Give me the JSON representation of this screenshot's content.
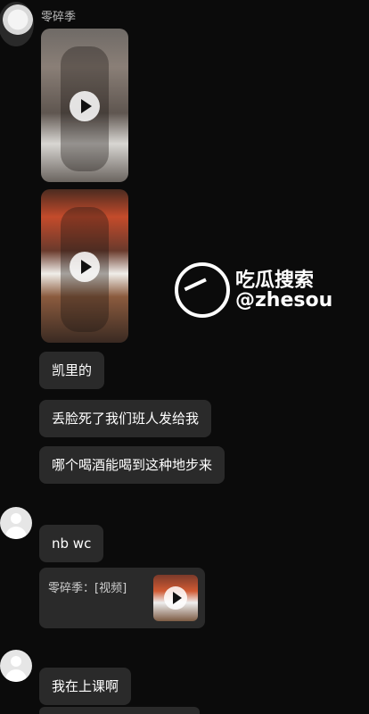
{
  "chat": {
    "sender_name": "零碎季",
    "messages": [
      {
        "text": "凯里的"
      },
      {
        "text": "丢脸死了我们班人发给我"
      },
      {
        "text": "哪个喝酒能喝到这种地步来"
      },
      {
        "text": "nb wc"
      },
      {
        "share_text": "零碎季：[视频]"
      },
      {
        "text": "我在上课啊"
      }
    ]
  },
  "watermark": {
    "title": "吃瓜搜索",
    "handle": "@zhesou"
  },
  "icons": {
    "play": "play-icon",
    "logo": "search-logo-icon"
  },
  "colors": {
    "background": "#0b0b0b",
    "bubble": "#2a2a2a",
    "text": "#ffffff"
  }
}
